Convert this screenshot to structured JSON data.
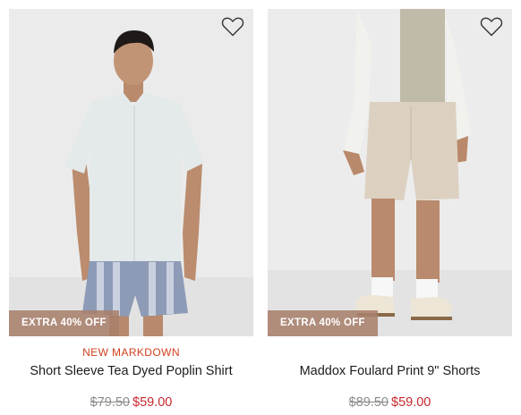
{
  "colors": {
    "promo_text": "#d2401e",
    "sale_price": "#c8282d",
    "badge_bg": "#a9806c"
  },
  "products": [
    {
      "badge": "EXTRA 40% OFF",
      "promo": "NEW MARKDOWN",
      "name": "Short Sleeve Tea Dyed Poplin Shirt",
      "original_price": "$79.50",
      "sale_price": "$59.00",
      "wishlist_icon": "heart-outline-icon"
    },
    {
      "badge": "EXTRA 40% OFF",
      "promo": "",
      "name": "Maddox Foulard Print 9\" Shorts",
      "original_price": "$89.50",
      "sale_price": "$59.00",
      "wishlist_icon": "heart-outline-icon"
    }
  ]
}
